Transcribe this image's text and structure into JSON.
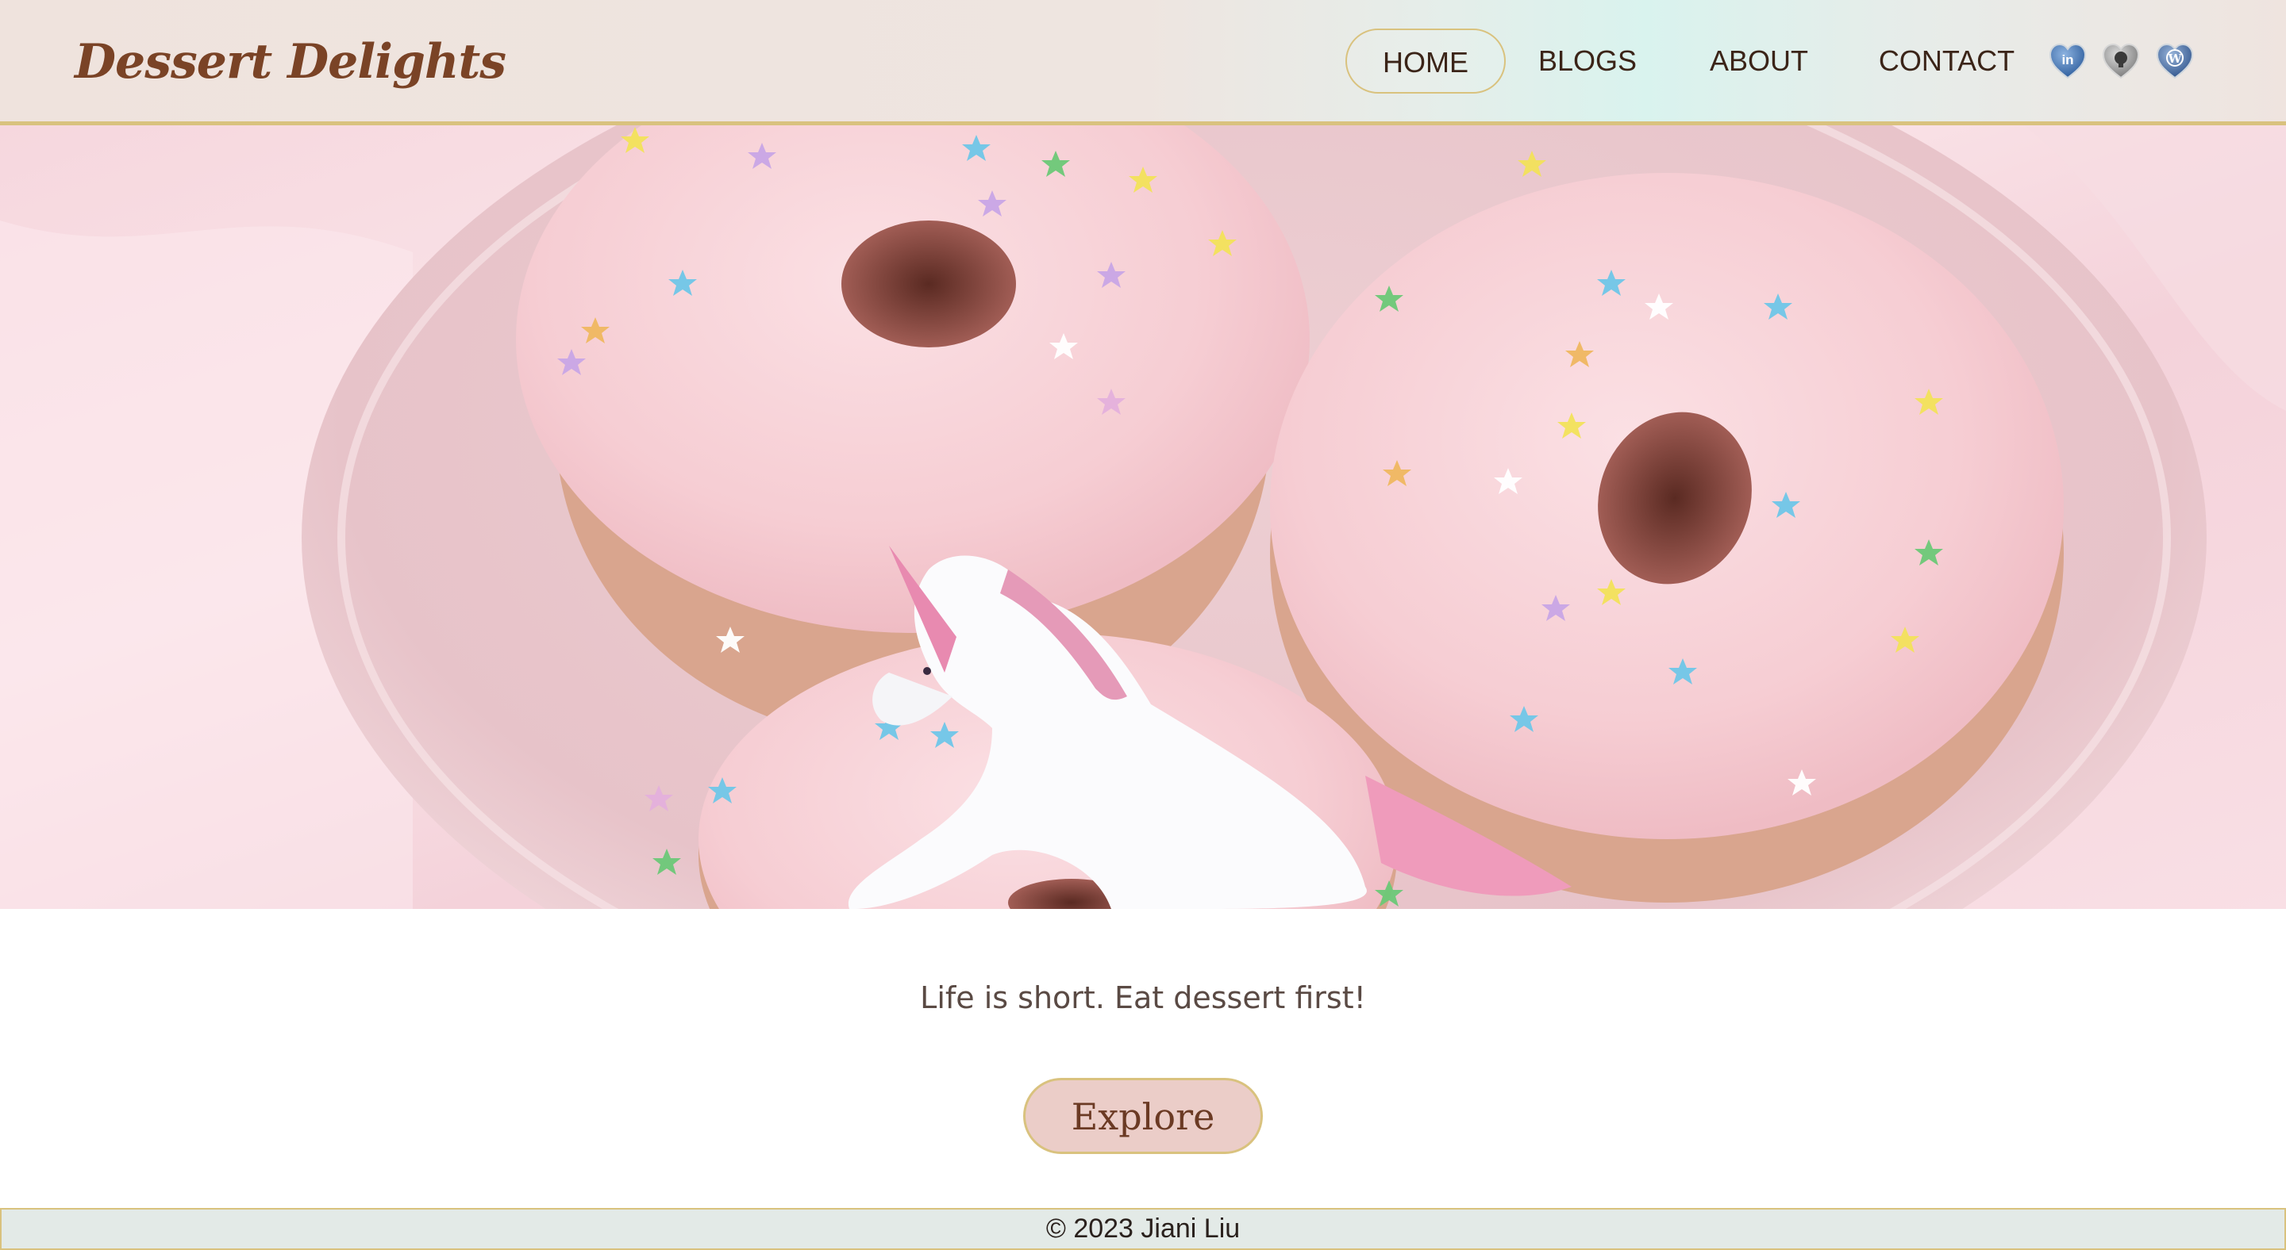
{
  "header": {
    "site_title": "Dessert Delights",
    "nav": [
      {
        "label": "HOME",
        "active": true
      },
      {
        "label": "BLOGS",
        "active": false
      },
      {
        "label": "ABOUT",
        "active": false
      },
      {
        "label": "CONTACT",
        "active": false
      }
    ],
    "social": [
      {
        "icon": "linkedin-icon",
        "color": "#3f74b5"
      },
      {
        "icon": "github-icon",
        "color": "#7a7a7a"
      },
      {
        "icon": "wordpress-icon",
        "color": "#4a6fa3"
      }
    ]
  },
  "hero": {
    "image": "pink-frosted-donuts-with-unicorn-figurine"
  },
  "main": {
    "tagline": "Life is short. Eat dessert first!",
    "cta_label": "Explore"
  },
  "footer": {
    "text": "© 2023 Jiani Liu"
  },
  "colors": {
    "brand": "#7a4326",
    "accent_border": "#d9c27e",
    "button_bg": "#ebcdc8",
    "footer_bg": "#e3eae7"
  }
}
